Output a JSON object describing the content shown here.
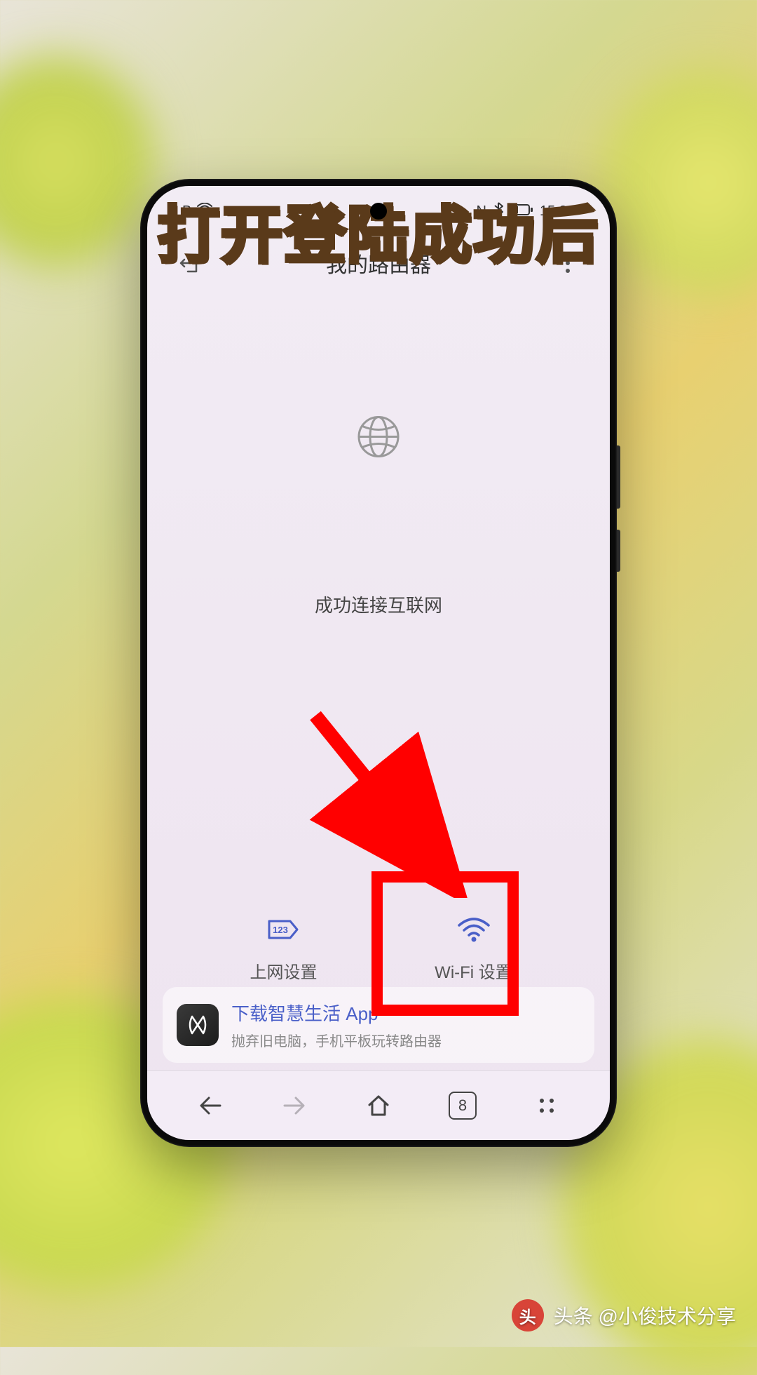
{
  "caption": "打开登陆成功后",
  "statusBar": {
    "indicatorB": "B",
    "nfc": "N",
    "time": "15:33"
  },
  "header": {
    "title": "我的路由器"
  },
  "main": {
    "statusText": "成功连接互联网"
  },
  "tiles": {
    "internet": "上网设置",
    "internetBadge": "123",
    "wifi": "Wi-Fi 设置"
  },
  "appCard": {
    "title": "下载智慧生活 App",
    "subtitle": "抛弃旧电脑，手机平板玩转路由器"
  },
  "nav": {
    "tabsCount": "8"
  },
  "watermark": {
    "badge": "头",
    "prefix": "头条 @",
    "author": "小俊技术分享"
  },
  "accent": {
    "highlight": "#ff0000",
    "link": "#4a5fc8"
  }
}
